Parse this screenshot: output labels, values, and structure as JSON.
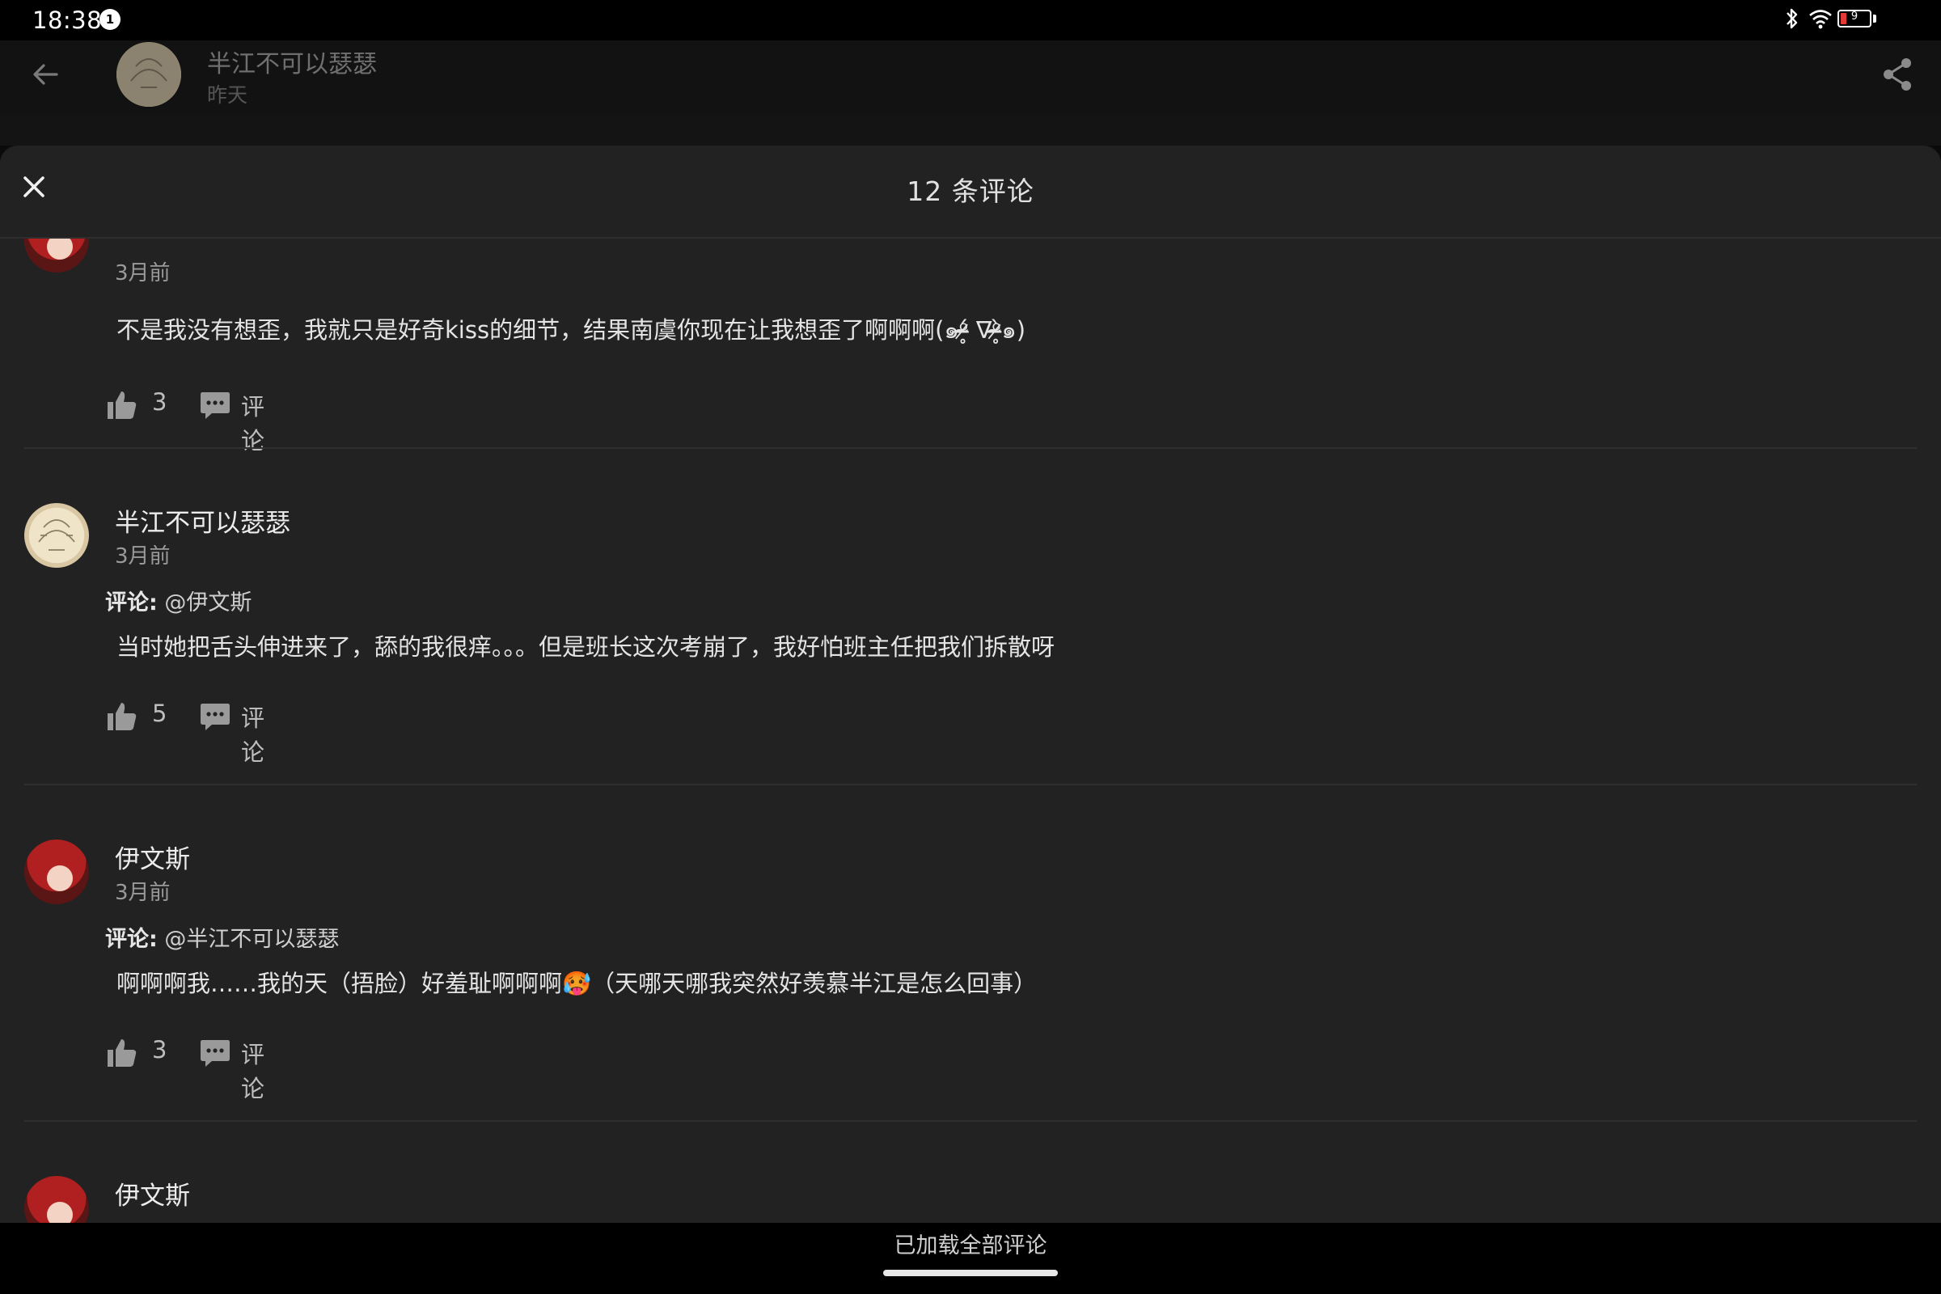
{
  "status_bar": {
    "time": "18:38",
    "notification_count": "1",
    "battery_level": "9"
  },
  "header": {
    "title": "半江不可以瑟瑟",
    "subtitle": "昨天"
  },
  "sheet": {
    "title": "12 条评论"
  },
  "comments": [
    {
      "time": "3月前",
      "text": "不是我没有想歪，我就只是好奇kiss的细节，结果南虞你现在让我想歪了啊啊啊(๑ᵒ̴̶̷̥́ ∇ᵒ̴̶̷̥̀๑)",
      "likes": "3",
      "comment_label": "评论"
    },
    {
      "name": "半江不可以瑟瑟",
      "time": "3月前",
      "reply_label": "评论:",
      "reply_target": "@伊文斯",
      "text": "当时她把舌头伸进来了，舔的我很痒。。。但是班长这次考崩了，我好怕班主任把我们拆散呀",
      "likes": "5",
      "comment_label": "评论"
    },
    {
      "name": "伊文斯",
      "time": "3月前",
      "reply_label": "评论:",
      "reply_target": "@半江不可以瑟瑟",
      "text": "啊啊啊我……我的天（捂脸）好羞耻啊啊啊🥵（天哪天哪我突然好羡慕半江是怎么回事）",
      "likes": "3",
      "comment_label": "评论"
    },
    {
      "name": "伊文斯"
    }
  ],
  "footer": {
    "loaded_text": "已加载全部评论"
  },
  "colors": {
    "sheet_bg": "#222222",
    "battery_low": "#e53935"
  }
}
